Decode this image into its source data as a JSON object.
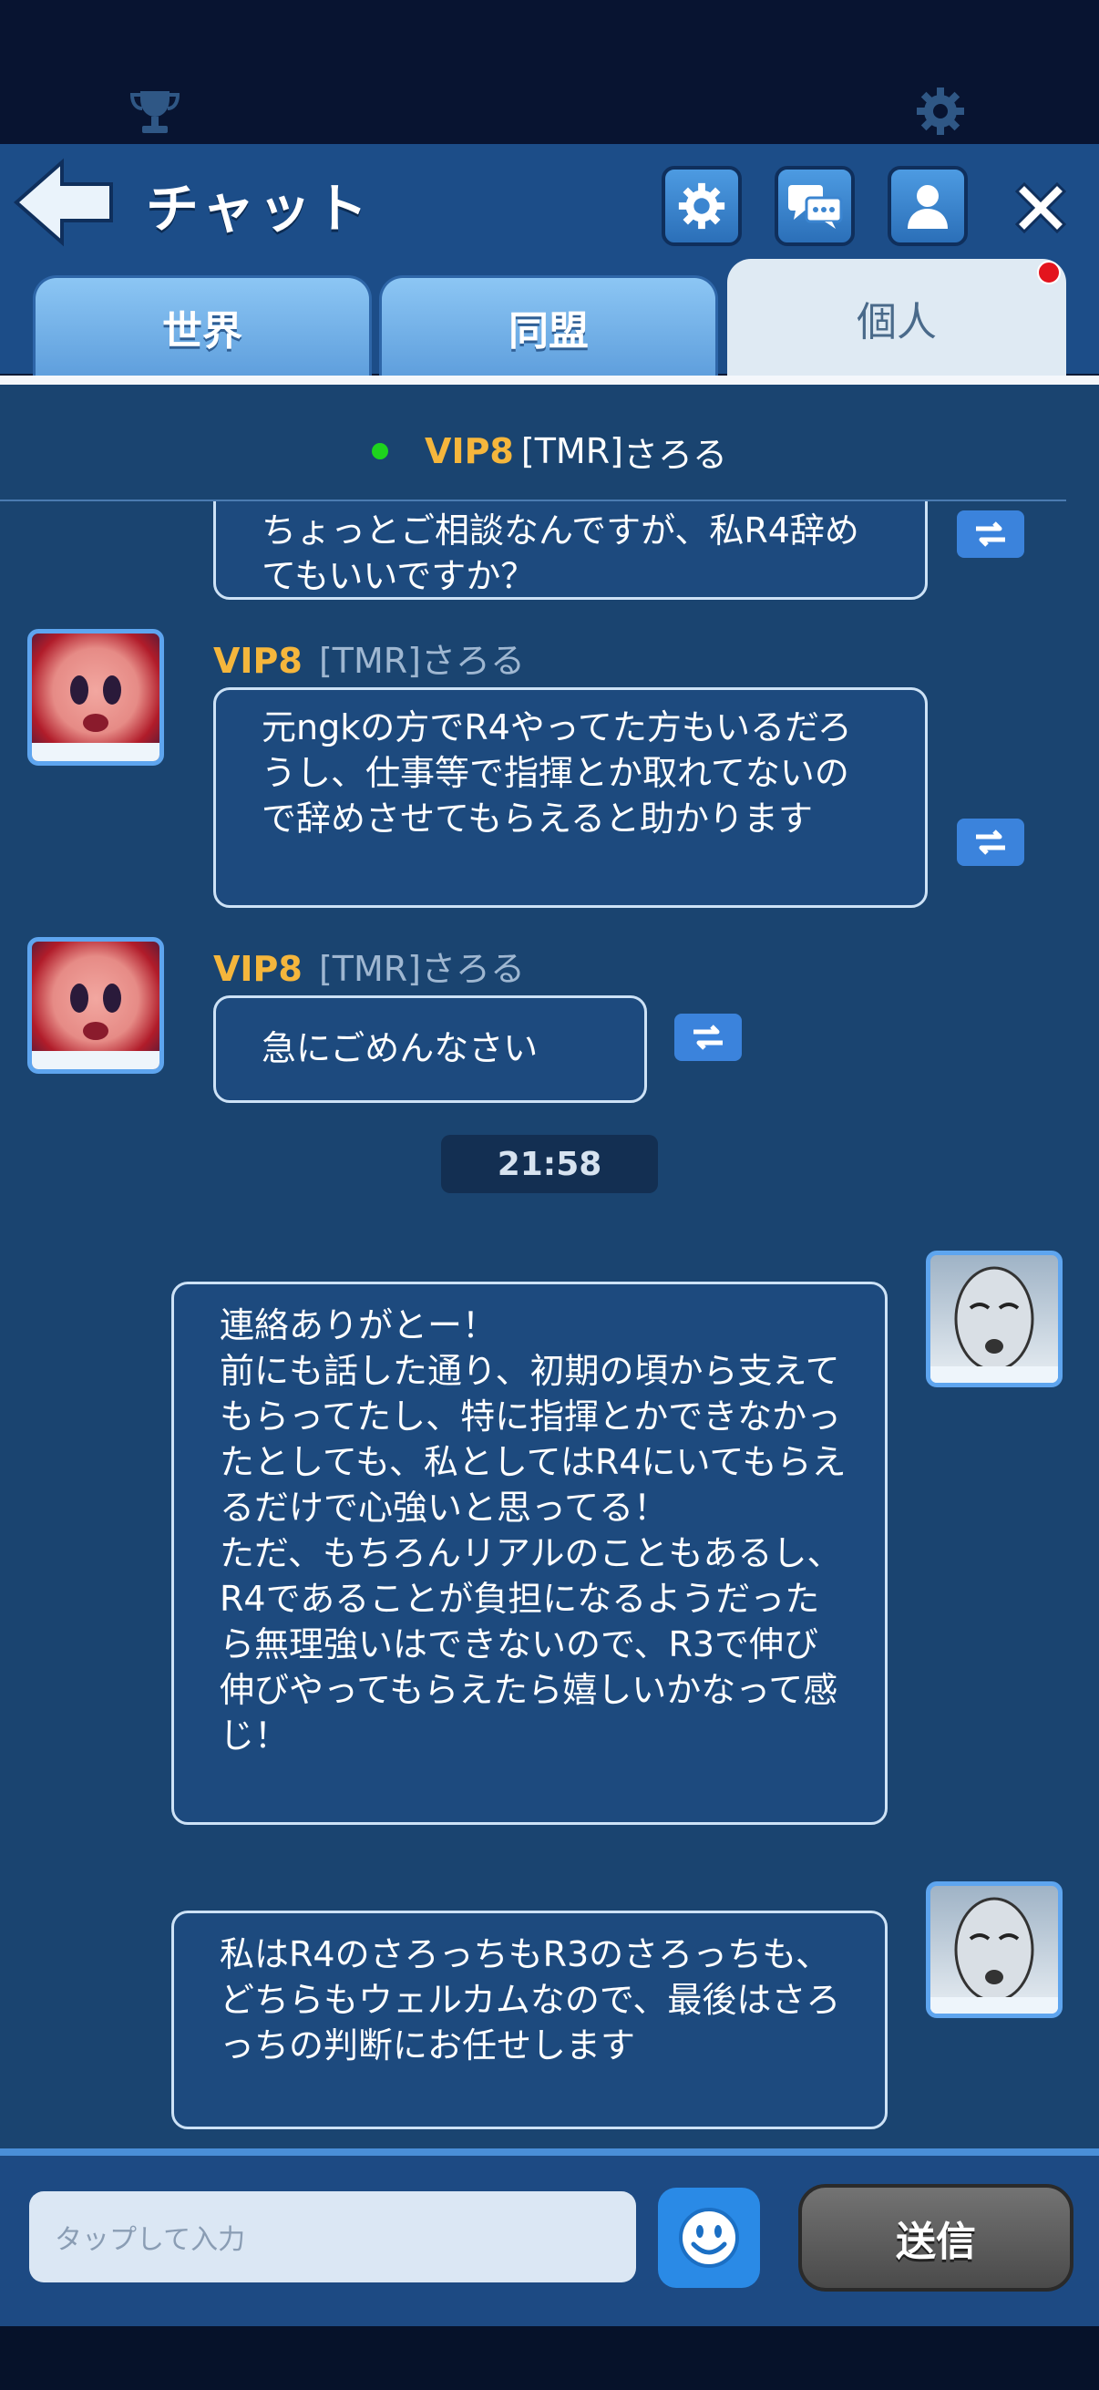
{
  "header": {
    "title": "チャット",
    "tabs": [
      {
        "label": "世界",
        "active": false
      },
      {
        "label": "同盟",
        "active": false
      },
      {
        "label": "個人",
        "active": true
      }
    ]
  },
  "contact": {
    "vip": "VIP8",
    "tag": "[TMR]",
    "name": "さろる"
  },
  "messages": [
    {
      "text": "ちょっとご相談なんですが、私R4辞めてもいいですか？"
    },
    {
      "vip": "VIP8",
      "tag": "[TMR]",
      "name": "さろる",
      "text": "元ngkの方でR4やってた方もいるだろうし、仕事等で指揮とか取れてないので辞めさせてもらえると助かります"
    },
    {
      "vip": "VIP8",
      "tag": "[TMR]",
      "name": "さろる",
      "text": "急にごめんなさい"
    },
    {
      "text": "連絡ありがとー！\n前にも話した通り、初期の頃から支えてもらってたし、特に指揮とかできなかったとしても、私としてはR4にいてもらえるだけで心強いと思ってる！\nただ、もちろんリアルのこともあるし、R4であることが負担になるようだったら無理強いはできないので、R3で伸び伸びやってもらえたら嬉しいかなって感じ！"
    },
    {
      "text": "私はR4のさろっちもR3のさろっちも、どちらもウェルカムなので、最後はさろっちの判断にお任せします"
    }
  ],
  "timestamp": "21:58",
  "composer": {
    "placeholder": "タップして入力",
    "send_label": "送信"
  },
  "colors": {
    "accent": "#2a8ae6",
    "vip": "#f5b63c",
    "header": "#1c4d88",
    "chat_bg": "#1a4470"
  }
}
